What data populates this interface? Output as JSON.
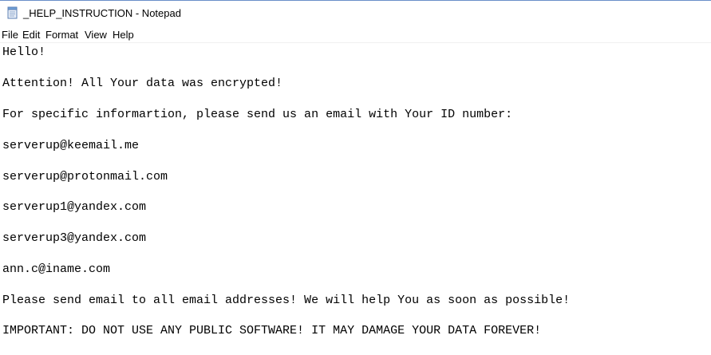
{
  "window": {
    "title": "_HELP_INSTRUCTION - Notepad",
    "icon": "notepad-icon"
  },
  "menu": {
    "items": [
      "File",
      "Edit",
      "Format",
      "View",
      "Help"
    ]
  },
  "document": {
    "lines": [
      "Hello!",
      "Attention! All Your data was encrypted!",
      "For specific informartion, please send us an email with Your ID number:",
      "serverup@keemail.me",
      "serverup@protonmail.com",
      "serverup1@yandex.com",
      "serverup3@yandex.com",
      "ann.c@iname.com",
      "Please send email to all email addresses! We will help You as soon as possible!",
      "IMPORTANT: DO NOT USE ANY PUBLIC SOFTWARE! IT MAY DAMAGE YOUR DATA FOREVER!"
    ]
  }
}
